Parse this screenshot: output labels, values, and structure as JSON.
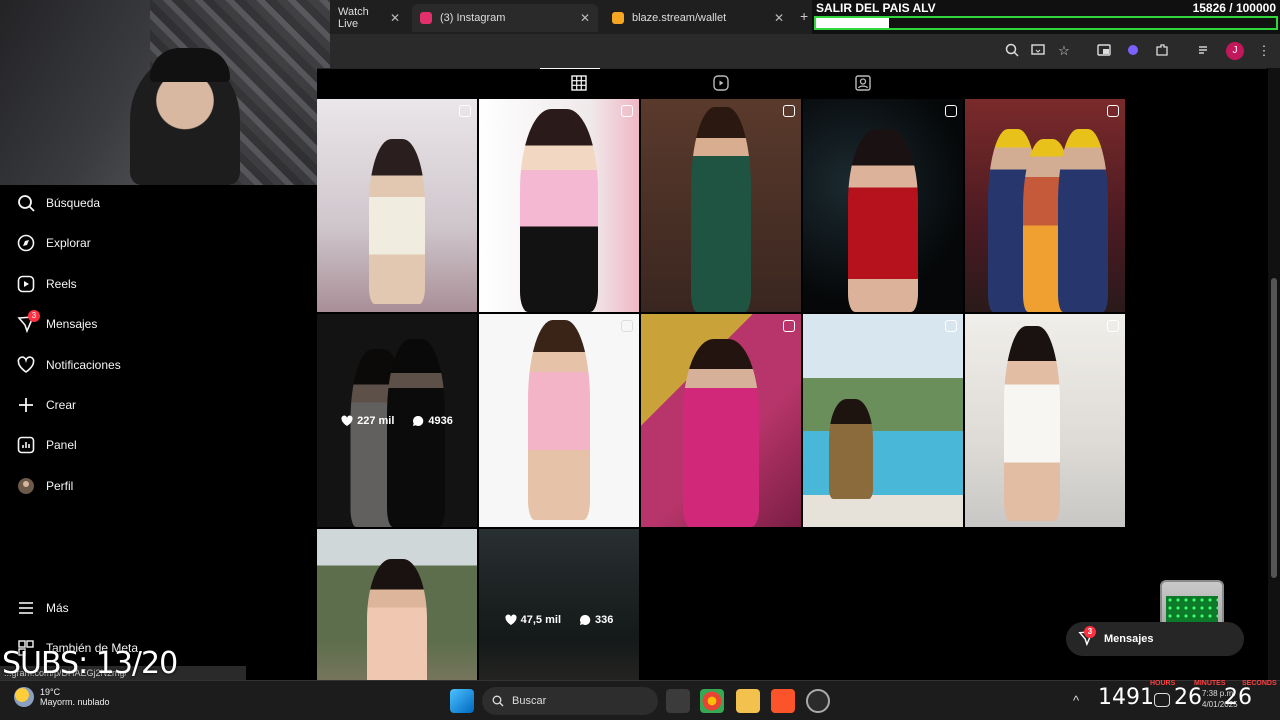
{
  "browser": {
    "tabs": [
      {
        "label": "Watch Live",
        "favicon_color": "#9146ff"
      },
      {
        "label": "(3) Instagram",
        "favicon_color": "#e1306c"
      },
      {
        "label": "blaze.stream/wallet",
        "favicon_color": "#f5a623"
      }
    ],
    "new_tab": "+",
    "profile_initial": "J",
    "status_url": "...gram.com/p/DHAEGj2N2mg/"
  },
  "goal": {
    "title": "SALIR DEL PAIS ALV",
    "count": "15826  / 100000",
    "progress_fraction": 0.158,
    "bar_color": "#31d63d"
  },
  "sidebar": {
    "items": [
      {
        "label": "Búsqueda",
        "icon": "search-icon"
      },
      {
        "label": "Explorar",
        "icon": "compass-icon"
      },
      {
        "label": "Reels",
        "icon": "reels-icon"
      },
      {
        "label": "Mensajes",
        "icon": "messenger-icon",
        "badge": "3"
      },
      {
        "label": "Notificaciones",
        "icon": "heart-icon"
      },
      {
        "label": "Crear",
        "icon": "plus-icon"
      },
      {
        "label": "Panel",
        "icon": "chart-icon"
      },
      {
        "label": "Perfil",
        "icon": "avatar-icon"
      }
    ],
    "more": "Más",
    "meta": "También de Meta"
  },
  "grid": {
    "hover_post": {
      "likes": "227 mil",
      "comments": "4936"
    },
    "hover_post_2": {
      "likes": "47,5 mil",
      "comments": "336"
    }
  },
  "messages_pill": {
    "label": "Mensajes",
    "badge": "3"
  },
  "overlay": {
    "subs": "SUBS: 13/20",
    "hours_label": "HOURS",
    "minutes_label": "MINUTES",
    "seconds_label": "SECONDS",
    "big_counter_1": "1491",
    "big_counter_2": "26",
    "big_counter_3": "26"
  },
  "taskbar": {
    "temperature": "19°C",
    "weather": "Mayorm. nublado",
    "search_label": "Buscar",
    "time": "7:38 p.m.",
    "date": "4/01/2025"
  },
  "colors": {
    "background": "#000000",
    "text": "#f5f5f5",
    "badge": "#ff3040"
  }
}
